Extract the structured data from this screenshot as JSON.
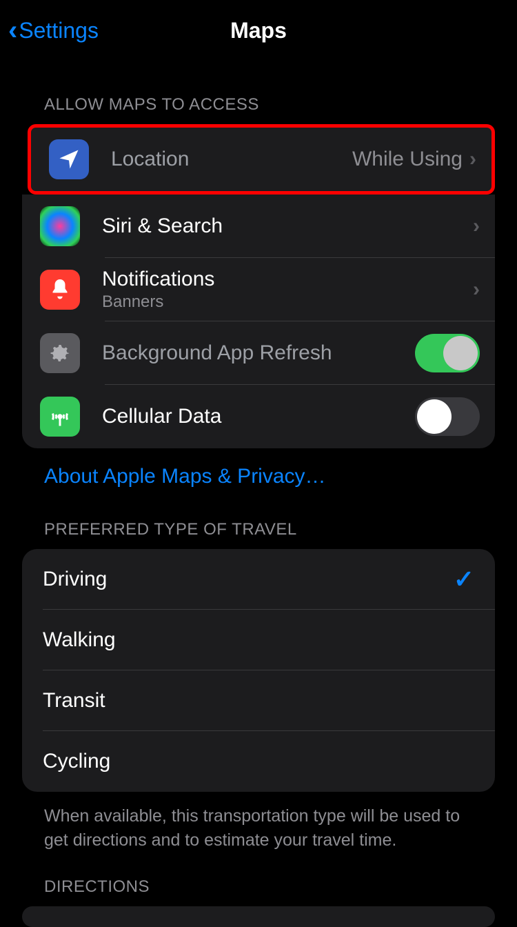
{
  "header": {
    "back_label": "Settings",
    "title": "Maps"
  },
  "sections": {
    "access": {
      "header": "ALLOW MAPS TO ACCESS",
      "location": {
        "label": "Location",
        "value": "While Using"
      },
      "siri": {
        "label": "Siri & Search"
      },
      "notifications": {
        "label": "Notifications",
        "sublabel": "Banners"
      },
      "refresh": {
        "label": "Background App Refresh",
        "enabled": true
      },
      "cellular": {
        "label": "Cellular Data",
        "enabled": false
      }
    },
    "privacy_link": "About Apple Maps & Privacy…",
    "travel": {
      "header": "PREFERRED TYPE OF TRAVEL",
      "options": [
        {
          "label": "Driving",
          "selected": true
        },
        {
          "label": "Walking",
          "selected": false
        },
        {
          "label": "Transit",
          "selected": false
        },
        {
          "label": "Cycling",
          "selected": false
        }
      ],
      "footer": "When available, this transportation type will be used to get directions and to estimate your travel time."
    },
    "directions": {
      "header": "DIRECTIONS"
    }
  }
}
